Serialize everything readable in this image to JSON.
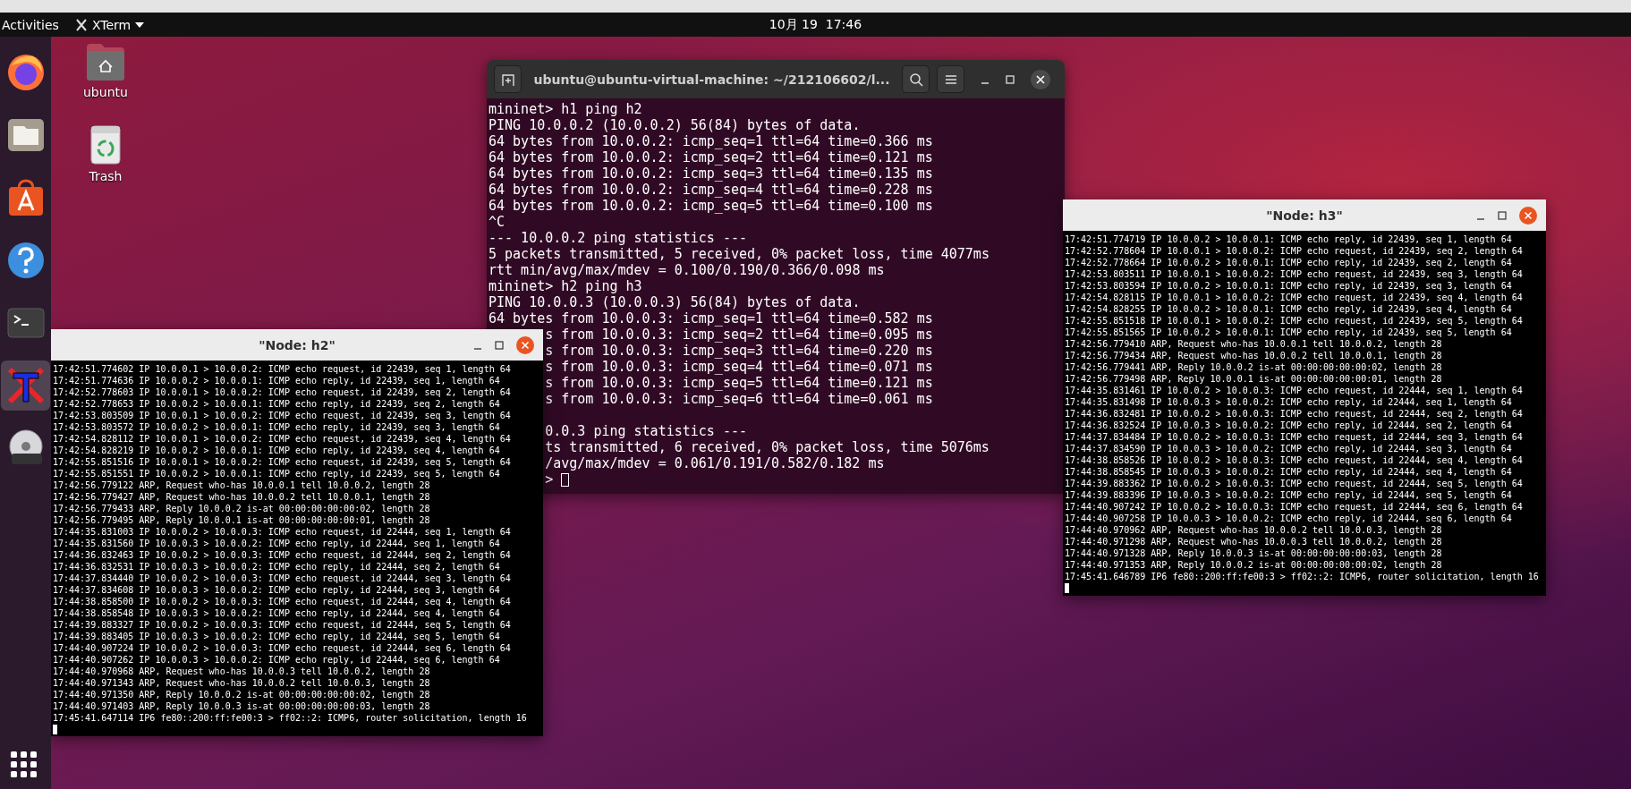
{
  "top_bar": {
    "activities": "Activities",
    "app_menu": "XTerm",
    "clock": "10月 19  17:46"
  },
  "dock": {
    "items": [
      {
        "kind": "browser",
        "selected": false
      },
      {
        "kind": "files",
        "selected": false
      },
      {
        "kind": "software",
        "selected": false
      },
      {
        "kind": "help",
        "selected": false
      },
      {
        "kind": "terminal",
        "selected": false
      },
      {
        "kind": "xterm",
        "selected": true
      },
      {
        "kind": "disc",
        "selected": false
      }
    ],
    "apps_button": {
      "kind": "grid"
    }
  },
  "desktop_icons": [
    {
      "kind": "home-folder",
      "label": "ubuntu"
    },
    {
      "kind": "trash",
      "label": "Trash"
    }
  ],
  "terminal": {
    "title": "ubuntu@ubuntu-virtual-machine: ~/212106602/l...",
    "lines": [
      "mininet> h1 ping h2",
      "PING 10.0.0.2 (10.0.0.2) 56(84) bytes of data.",
      "64 bytes from 10.0.0.2: icmp_seq=1 ttl=64 time=0.366 ms",
      "64 bytes from 10.0.0.2: icmp_seq=2 ttl=64 time=0.121 ms",
      "64 bytes from 10.0.0.2: icmp_seq=3 ttl=64 time=0.135 ms",
      "64 bytes from 10.0.0.2: icmp_seq=4 ttl=64 time=0.228 ms",
      "64 bytes from 10.0.0.2: icmp_seq=5 ttl=64 time=0.100 ms",
      "^C",
      "--- 10.0.0.2 ping statistics ---",
      "5 packets transmitted, 5 received, 0% packet loss, time 4077ms",
      "rtt min/avg/max/mdev = 0.100/0.190/0.366/0.098 ms",
      "mininet> h2 ping h3",
      "PING 10.0.0.3 (10.0.0.3) 56(84) bytes of data.",
      "64 bytes from 10.0.0.3: icmp_seq=1 ttl=64 time=0.582 ms"
    ],
    "covered_replies": [
      "s from 10.0.0.3: icmp_seq=2 ttl=64 time=0.095 ms",
      "s from 10.0.0.3: icmp_seq=3 ttl=64 time=0.220 ms",
      "s from 10.0.0.3: icmp_seq=4 ttl=64 time=0.071 ms",
      "s from 10.0.0.3: icmp_seq=5 ttl=64 time=0.121 ms",
      "s from 10.0.0.3: icmp_seq=6 ttl=64 time=0.061 ms"
    ],
    "covered_stats": [
      "0.0.3 ping statistics ---",
      "ts transmitted, 6 received, 0% packet loss, time 5076ms",
      "/avg/max/mdev = 0.061/0.191/0.582/0.182 ms"
    ],
    "prompt": ">"
  },
  "node_windows": [
    {
      "title": "\"Node: h2\"",
      "lines": [
        "17:42:51.774602 IP 10.0.0.1 > 10.0.0.2: ICMP echo request, id 22439, seq 1, length 64",
        "17:42:51.774636 IP 10.0.0.2 > 10.0.0.1: ICMP echo reply, id 22439, seq 1, length 64",
        "17:42:52.778603 IP 10.0.0.1 > 10.0.0.2: ICMP echo request, id 22439, seq 2, length 64",
        "17:42:52.778653 IP 10.0.0.2 > 10.0.0.1: ICMP echo reply, id 22439, seq 2, length 64",
        "17:42:53.803509 IP 10.0.0.1 > 10.0.0.2: ICMP echo request, id 22439, seq 3, length 64",
        "17:42:53.803572 IP 10.0.0.2 > 10.0.0.1: ICMP echo reply, id 22439, seq 3, length 64",
        "17:42:54.828112 IP 10.0.0.1 > 10.0.0.2: ICMP echo request, id 22439, seq 4, length 64",
        "17:42:54.828219 IP 10.0.0.2 > 10.0.0.1: ICMP echo reply, id 22439, seq 4, length 64",
        "17:42:55.851516 IP 10.0.0.1 > 10.0.0.2: ICMP echo request, id 22439, seq 5, length 64",
        "17:42:55.851551 IP 10.0.0.2 > 10.0.0.1: ICMP echo reply, id 22439, seq 5, length 64",
        "17:42:56.779122 ARP, Request who-has 10.0.0.1 tell 10.0.0.2, length 28",
        "17:42:56.779427 ARP, Request who-has 10.0.0.2 tell 10.0.0.1, length 28",
        "17:42:56.779433 ARP, Reply 10.0.0.2 is-at 00:00:00:00:00:02, length 28",
        "17:42:56.779495 ARP, Reply 10.0.0.1 is-at 00:00:00:00:00:01, length 28",
        "17:44:35.831003 IP 10.0.0.2 > 10.0.0.3: ICMP echo request, id 22444, seq 1, length 64",
        "17:44:35.831560 IP 10.0.0.3 > 10.0.0.2: ICMP echo reply, id 22444, seq 1, length 64",
        "17:44:36.832463 IP 10.0.0.2 > 10.0.0.3: ICMP echo request, id 22444, seq 2, length 64",
        "17:44:36.832531 IP 10.0.0.3 > 10.0.0.2: ICMP echo reply, id 22444, seq 2, length 64",
        "17:44:37.834440 IP 10.0.0.2 > 10.0.0.3: ICMP echo request, id 22444, seq 3, length 64",
        "17:44:37.834608 IP 10.0.0.3 > 10.0.0.2: ICMP echo reply, id 22444, seq 3, length 64",
        "17:44:38.858500 IP 10.0.0.2 > 10.0.0.3: ICMP echo request, id 22444, seq 4, length 64",
        "17:44:38.858548 IP 10.0.0.3 > 10.0.0.2: ICMP echo reply, id 22444, seq 4, length 64",
        "17:44:39.883327 IP 10.0.0.2 > 10.0.0.3: ICMP echo request, id 22444, seq 5, length 64",
        "17:44:39.883405 IP 10.0.0.3 > 10.0.0.2: ICMP echo reply, id 22444, seq 5, length 64",
        "17:44:40.907224 IP 10.0.0.2 > 10.0.0.3: ICMP echo request, id 22444, seq 6, length 64",
        "17:44:40.907262 IP 10.0.0.3 > 10.0.0.2: ICMP echo reply, id 22444, seq 6, length 64",
        "17:44:40.970968 ARP, Request who-has 10.0.0.3 tell 10.0.0.2, length 28",
        "17:44:40.971343 ARP, Request who-has 10.0.0.2 tell 10.0.0.3, length 28",
        "17:44:40.971350 ARP, Reply 10.0.0.2 is-at 00:00:00:00:00:02, length 28",
        "17:44:40.971403 ARP, Reply 10.0.0.3 is-at 00:00:00:00:00:03, length 28",
        "17:45:41.647114 IP6 fe80::200:ff:fe00:3 > ff02::2: ICMP6, router solicitation, length 16"
      ]
    },
    {
      "title": "\"Node: h3\"",
      "lines": [
        "17:42:51.774719 IP 10.0.0.2 > 10.0.0.1: ICMP echo reply, id 22439, seq 1, length 64",
        "17:42:52.778604 IP 10.0.0.1 > 10.0.0.2: ICMP echo request, id 22439, seq 2, length 64",
        "17:42:52.778664 IP 10.0.0.2 > 10.0.0.1: ICMP echo reply, id 22439, seq 2, length 64",
        "17:42:53.803511 IP 10.0.0.1 > 10.0.0.2: ICMP echo request, id 22439, seq 3, length 64",
        "17:42:53.803594 IP 10.0.0.2 > 10.0.0.1: ICMP echo reply, id 22439, seq 3, length 64",
        "17:42:54.828115 IP 10.0.0.1 > 10.0.0.2: ICMP echo request, id 22439, seq 4, length 64",
        "17:42:54.828255 IP 10.0.0.2 > 10.0.0.1: ICMP echo reply, id 22439, seq 4, length 64",
        "17:42:55.851518 IP 10.0.0.1 > 10.0.0.2: ICMP echo request, id 22439, seq 5, length 64",
        "17:42:55.851565 IP 10.0.0.2 > 10.0.0.1: ICMP echo reply, id 22439, seq 5, length 64",
        "17:42:56.779410 ARP, Request who-has 10.0.0.1 tell 10.0.0.2, length 28",
        "17:42:56.779434 ARP, Request who-has 10.0.0.2 tell 10.0.0.1, length 28",
        "17:42:56.779441 ARP, Reply 10.0.0.2 is-at 00:00:00:00:00:02, length 28",
        "17:42:56.779498 ARP, Reply 10.0.0.1 is-at 00:00:00:00:00:01, length 28",
        "17:44:35.831461 IP 10.0.0.2 > 10.0.0.3: ICMP echo request, id 22444, seq 1, length 64",
        "17:44:35.831498 IP 10.0.0.3 > 10.0.0.2: ICMP echo reply, id 22444, seq 1, length 64",
        "17:44:36.832481 IP 10.0.0.2 > 10.0.0.3: ICMP echo request, id 22444, seq 2, length 64",
        "17:44:36.832524 IP 10.0.0.3 > 10.0.0.2: ICMP echo reply, id 22444, seq 2, length 64",
        "17:44:37.834484 IP 10.0.0.2 > 10.0.0.3: ICMP echo request, id 22444, seq 3, length 64",
        "17:44:37.834590 IP 10.0.0.3 > 10.0.0.2: ICMP echo reply, id 22444, seq 3, length 64",
        "17:44:38.858526 IP 10.0.0.2 > 10.0.0.3: ICMP echo request, id 22444, seq 4, length 64",
        "17:44:38.858545 IP 10.0.0.3 > 10.0.0.2: ICMP echo reply, id 22444, seq 4, length 64",
        "17:44:39.883362 IP 10.0.0.2 > 10.0.0.3: ICMP echo request, id 22444, seq 5, length 64",
        "17:44:39.883396 IP 10.0.0.3 > 10.0.0.2: ICMP echo reply, id 22444, seq 5, length 64",
        "17:44:40.907242 IP 10.0.0.2 > 10.0.0.3: ICMP echo request, id 22444, seq 6, length 64",
        "17:44:40.907258 IP 10.0.0.3 > 10.0.0.2: ICMP echo reply, id 22444, seq 6, length 64",
        "17:44:40.970962 ARP, Request who-has 10.0.0.2 tell 10.0.0.3, length 28",
        "17:44:40.971298 ARP, Request who-has 10.0.0.3 tell 10.0.0.2, length 28",
        "17:44:40.971328 ARP, Reply 10.0.0.3 is-at 00:00:00:00:00:03, length 28",
        "17:44:40.971353 ARP, Reply 10.0.0.2 is-at 00:00:00:00:00:02, length 28",
        "17:45:41.646789 IP6 fe80::200:ff:fe00:3 > ff02::2: ICMP6, router solicitation, length 16"
      ]
    }
  ]
}
